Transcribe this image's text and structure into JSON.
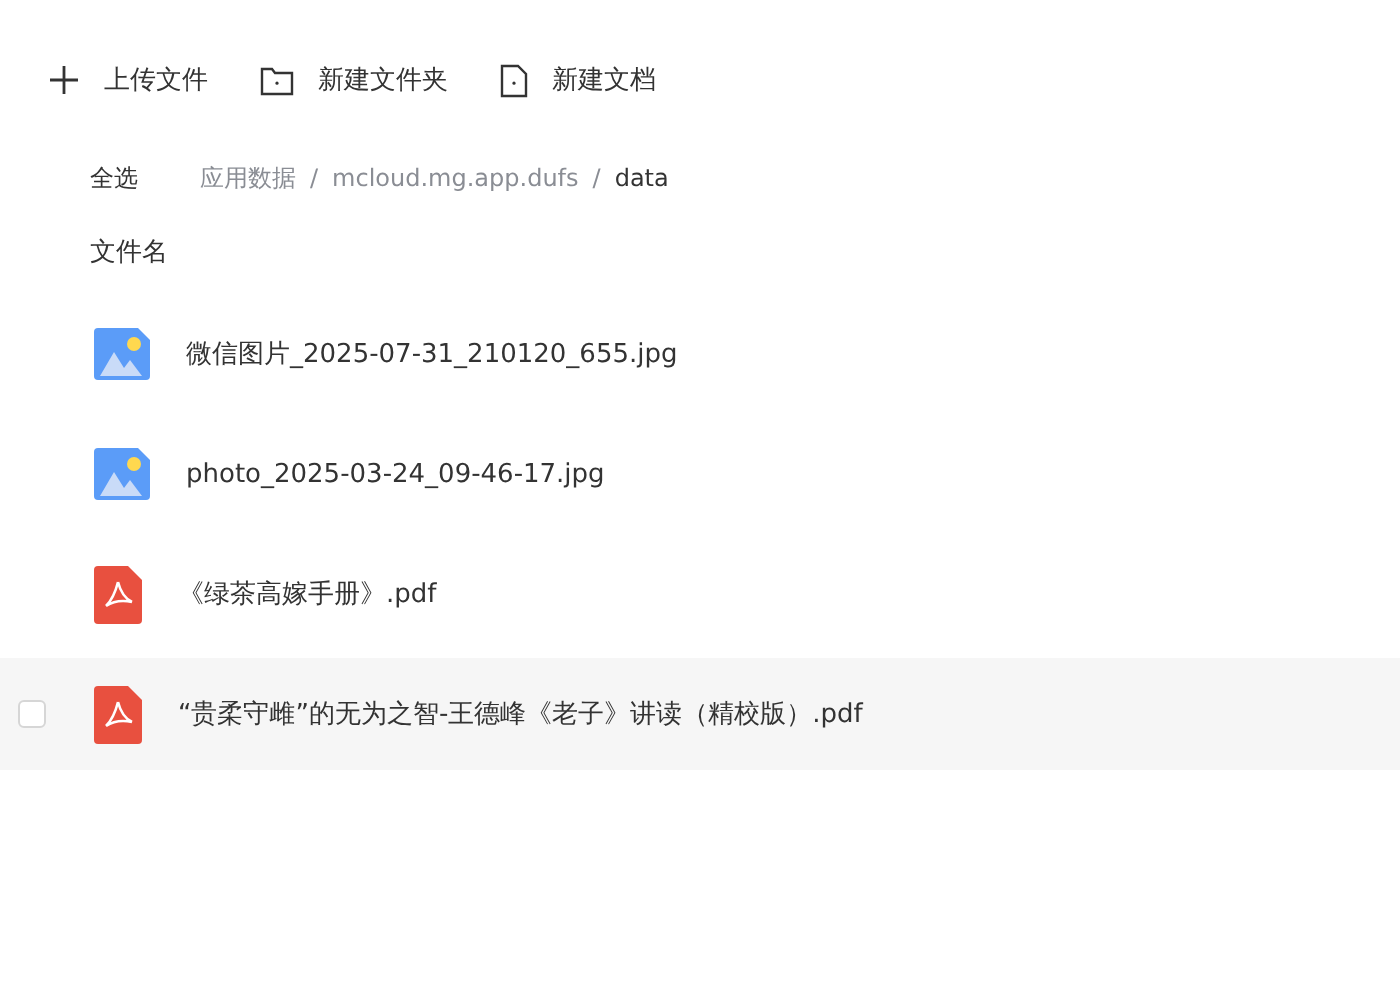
{
  "toolbar": [
    {
      "kind": "upload",
      "label": "上传文件"
    },
    {
      "kind": "folder",
      "label": "新建文件夹"
    },
    {
      "kind": "document",
      "label": "新建文档"
    }
  ],
  "select_all": "全选",
  "breadcrumb": [
    {
      "kind": "link",
      "label": "应用数据",
      "selected": false
    },
    {
      "kind": "separator",
      "label": "/"
    },
    {
      "kind": "link",
      "label": "mcloud.mg.app.dufs",
      "selected": false
    },
    {
      "kind": "separator",
      "label": "/"
    },
    {
      "kind": "link",
      "label": "data",
      "selected": true
    }
  ],
  "column_header": "文件名",
  "files": [
    {
      "kind": "image",
      "name": "微信图片_2025-07-31_210120_655.jpg",
      "hovered": false
    },
    {
      "kind": "image",
      "name": "photo_2025-03-24_09-46-17.jpg",
      "hovered": false
    },
    {
      "kind": "pdf",
      "name": "《绿茶高嫁手册》.pdf",
      "hovered": false
    },
    {
      "kind": "pdf",
      "name": "“贵柔守雌”的无为之智-王德峰《老子》讲读（精校版）.pdf",
      "hovered": true,
      "checked": false
    }
  ]
}
